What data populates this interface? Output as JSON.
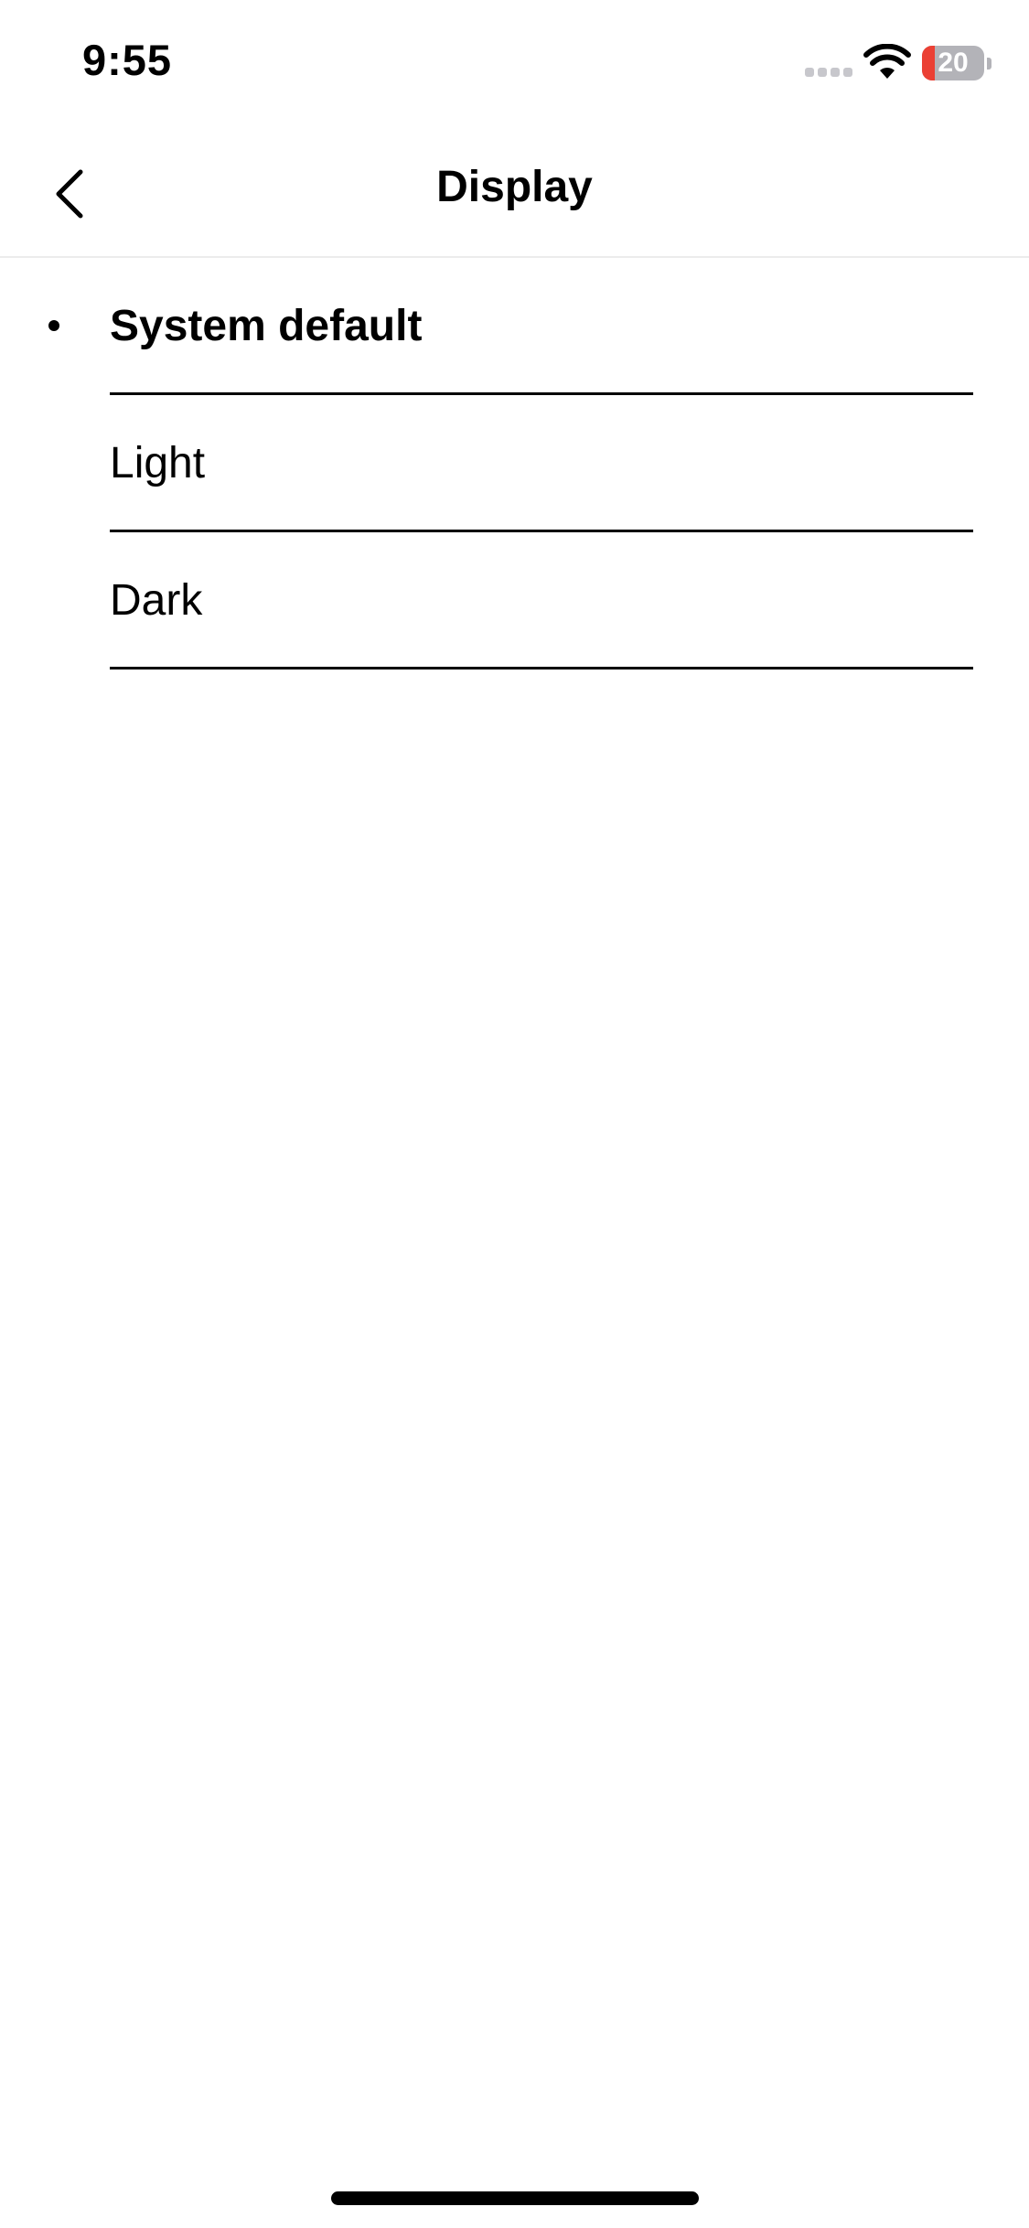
{
  "status_bar": {
    "time": "9:55",
    "battery_level": 20,
    "battery_label": "20",
    "battery_color": "#eb4034"
  },
  "header": {
    "back_icon": "chevron-left-icon",
    "title": "Display"
  },
  "options": [
    {
      "label": "System default",
      "selected": true
    },
    {
      "label": "Light",
      "selected": false
    },
    {
      "label": "Dark",
      "selected": false
    }
  ]
}
